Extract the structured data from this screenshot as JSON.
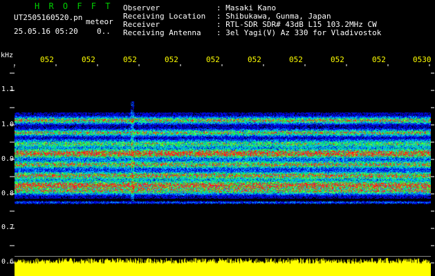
{
  "header": {
    "brand": "H R O F F T",
    "filename": "UT2505160520.pn",
    "mode": "meteor",
    "datetime": "25.05.16 05:20",
    "extra": "0..",
    "fields": [
      {
        "label": "Observer",
        "value": ": Masaki Kano"
      },
      {
        "label": "Receiving Location",
        "value": ": Shibukawa, Gunma, Japan"
      },
      {
        "label": "Receiver",
        "value": ": RTL-SDR SDR# 43dB L15 103.2MHz CW"
      },
      {
        "label": "Receiving Antenna",
        "value": ": 3el Yagi(V) Az 330 for Vladivostok"
      }
    ]
  },
  "axis": {
    "unit": "kHz",
    "time_labels": [
      "052",
      "052",
      "052",
      "052",
      "052",
      "052",
      "052",
      "052",
      "052",
      "0530"
    ],
    "freq_labels": [
      "1.1",
      "1.0",
      "0.9",
      "0.8",
      "0.7",
      "0.6"
    ]
  },
  "colors": {
    "text": "#ffffff",
    "axis_label": "#ffff00",
    "brand": "#00d000",
    "signal_strong": "#ff3030",
    "signal_mid": "#00ff40",
    "signal_low": "#0030ff",
    "noise_bar": "#ffff00"
  }
}
